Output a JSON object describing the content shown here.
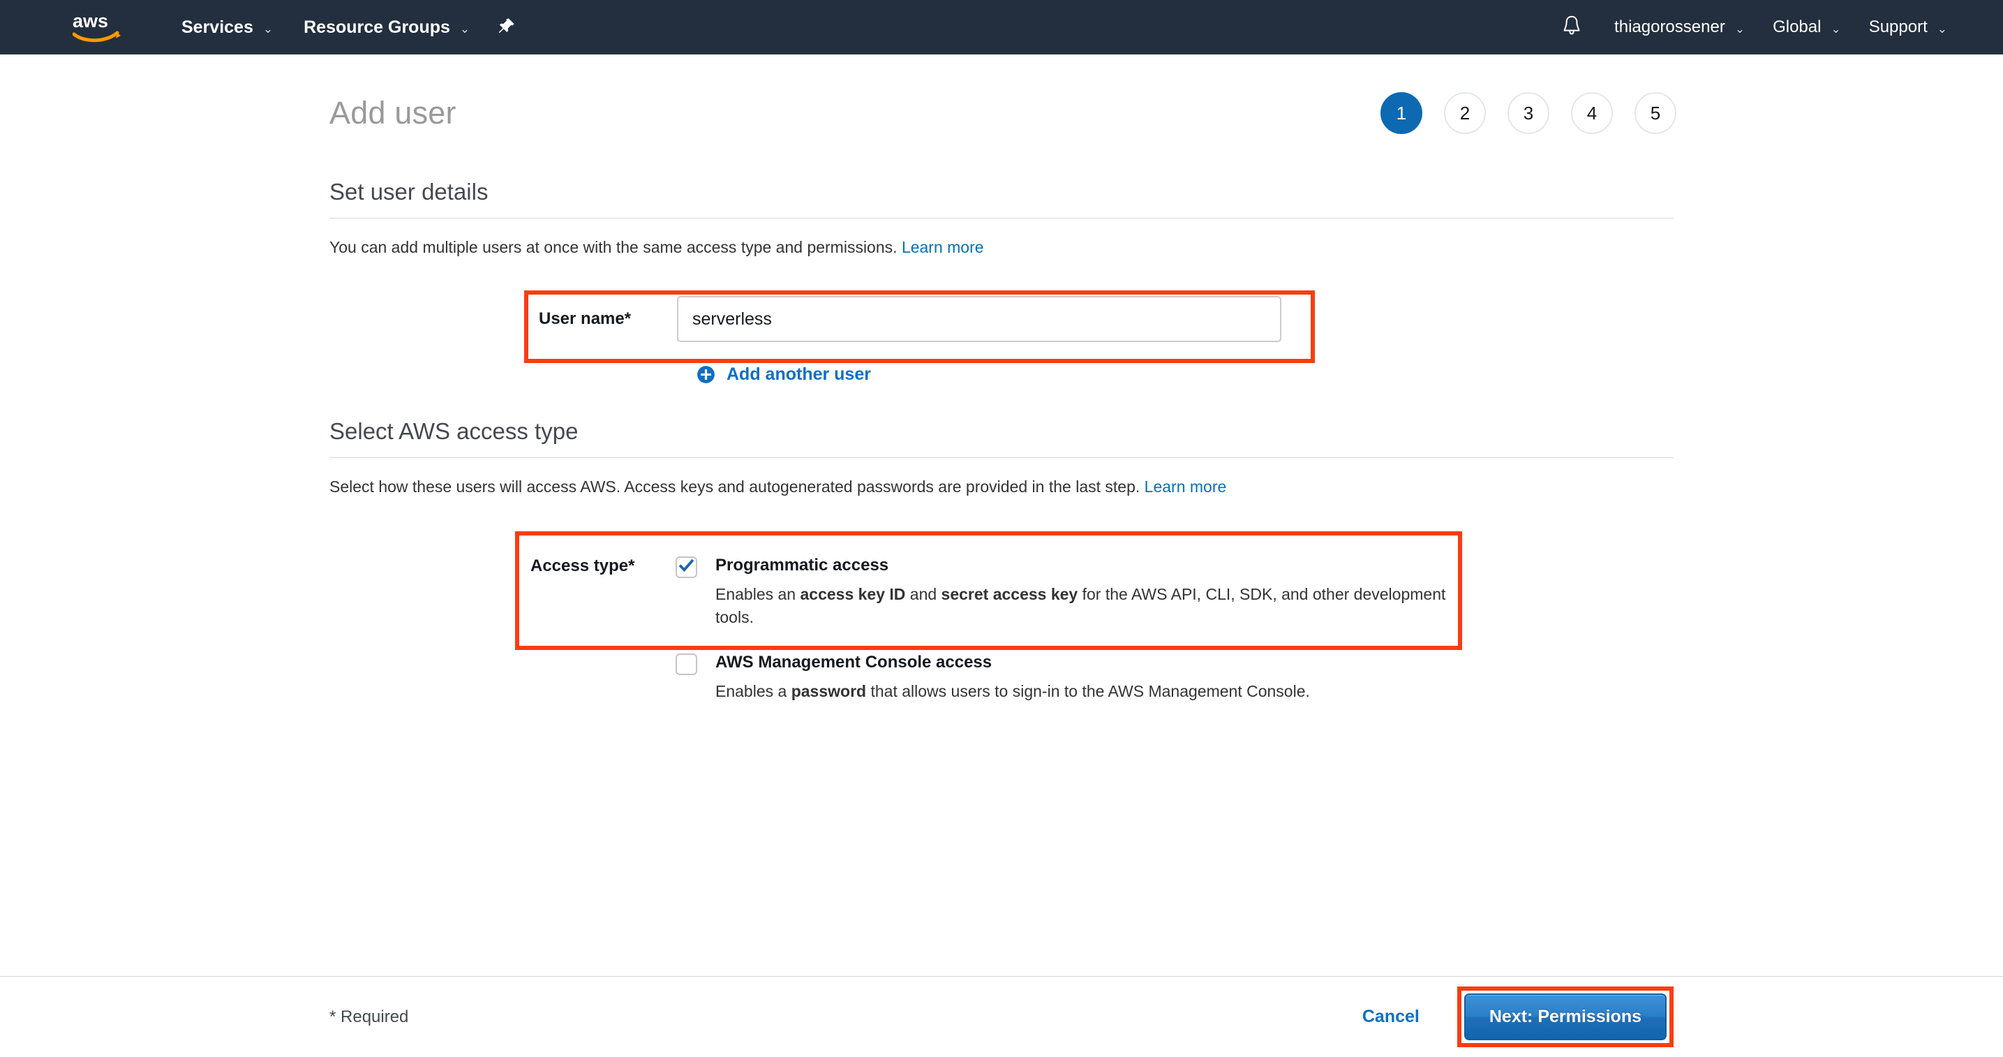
{
  "topnav": {
    "logo_alt": "aws-logo",
    "left_items": [
      {
        "label": "Services",
        "caret": "⌄"
      },
      {
        "label": "Resource Groups",
        "caret": "⌄"
      }
    ],
    "pin_icon": "pushpin-icon",
    "bell_icon": "notifications-bell-icon",
    "right_items": [
      {
        "label": "thiagorossener",
        "caret": "⌄"
      },
      {
        "label": "Global",
        "caret": "⌄"
      },
      {
        "label": "Support",
        "caret": "⌄"
      }
    ]
  },
  "header": {
    "title": "Add user",
    "steps": [
      {
        "number": "1",
        "active": true
      },
      {
        "number": "2",
        "active": false
      },
      {
        "number": "3",
        "active": false
      },
      {
        "number": "4",
        "active": false
      },
      {
        "number": "5",
        "active": false
      }
    ]
  },
  "user_details": {
    "section_title": "Set user details",
    "description": "You can add multiple users at once with the same access type and permissions.",
    "learn_more": "Learn more",
    "username_label": "User name*",
    "username_value": "serverless",
    "username_placeholder": "",
    "add_another_label": "Add another user",
    "add_another_icon": "plus-circle-icon"
  },
  "access_type": {
    "section_title": "Select AWS access type",
    "description": "Select how these users will access AWS. Access keys and autogenerated passwords are provided in the last step.",
    "learn_more": "Learn more",
    "label": "Access type*",
    "options": [
      {
        "title": "Programmatic access",
        "checked": true,
        "desc_part1": "Enables an ",
        "desc_bold1": "access key ID",
        "desc_part2": " and ",
        "desc_bold2": "secret access key",
        "desc_part3": " for the AWS API, CLI, SDK, and other development tools."
      },
      {
        "title": "AWS Management Console access",
        "checked": false,
        "desc_part1": "Enables a ",
        "desc_bold1": "password",
        "desc_part2": " that allows users to sign-in to the AWS Management Console.",
        "desc_bold2": "",
        "desc_part3": ""
      }
    ]
  },
  "footer": {
    "required_note": "* Required",
    "cancel_label": "Cancel",
    "next_label": "Next: Permissions"
  },
  "colors": {
    "nav_background": "#232f3e",
    "aws_orange": "#ff9900",
    "accent_blue": "#0073bb",
    "active_step_blue": "#0d6ab2",
    "highlight_red": "#fa3c11",
    "link_blue": "#0f6fc4",
    "button_blue": "#2a7fc9"
  }
}
